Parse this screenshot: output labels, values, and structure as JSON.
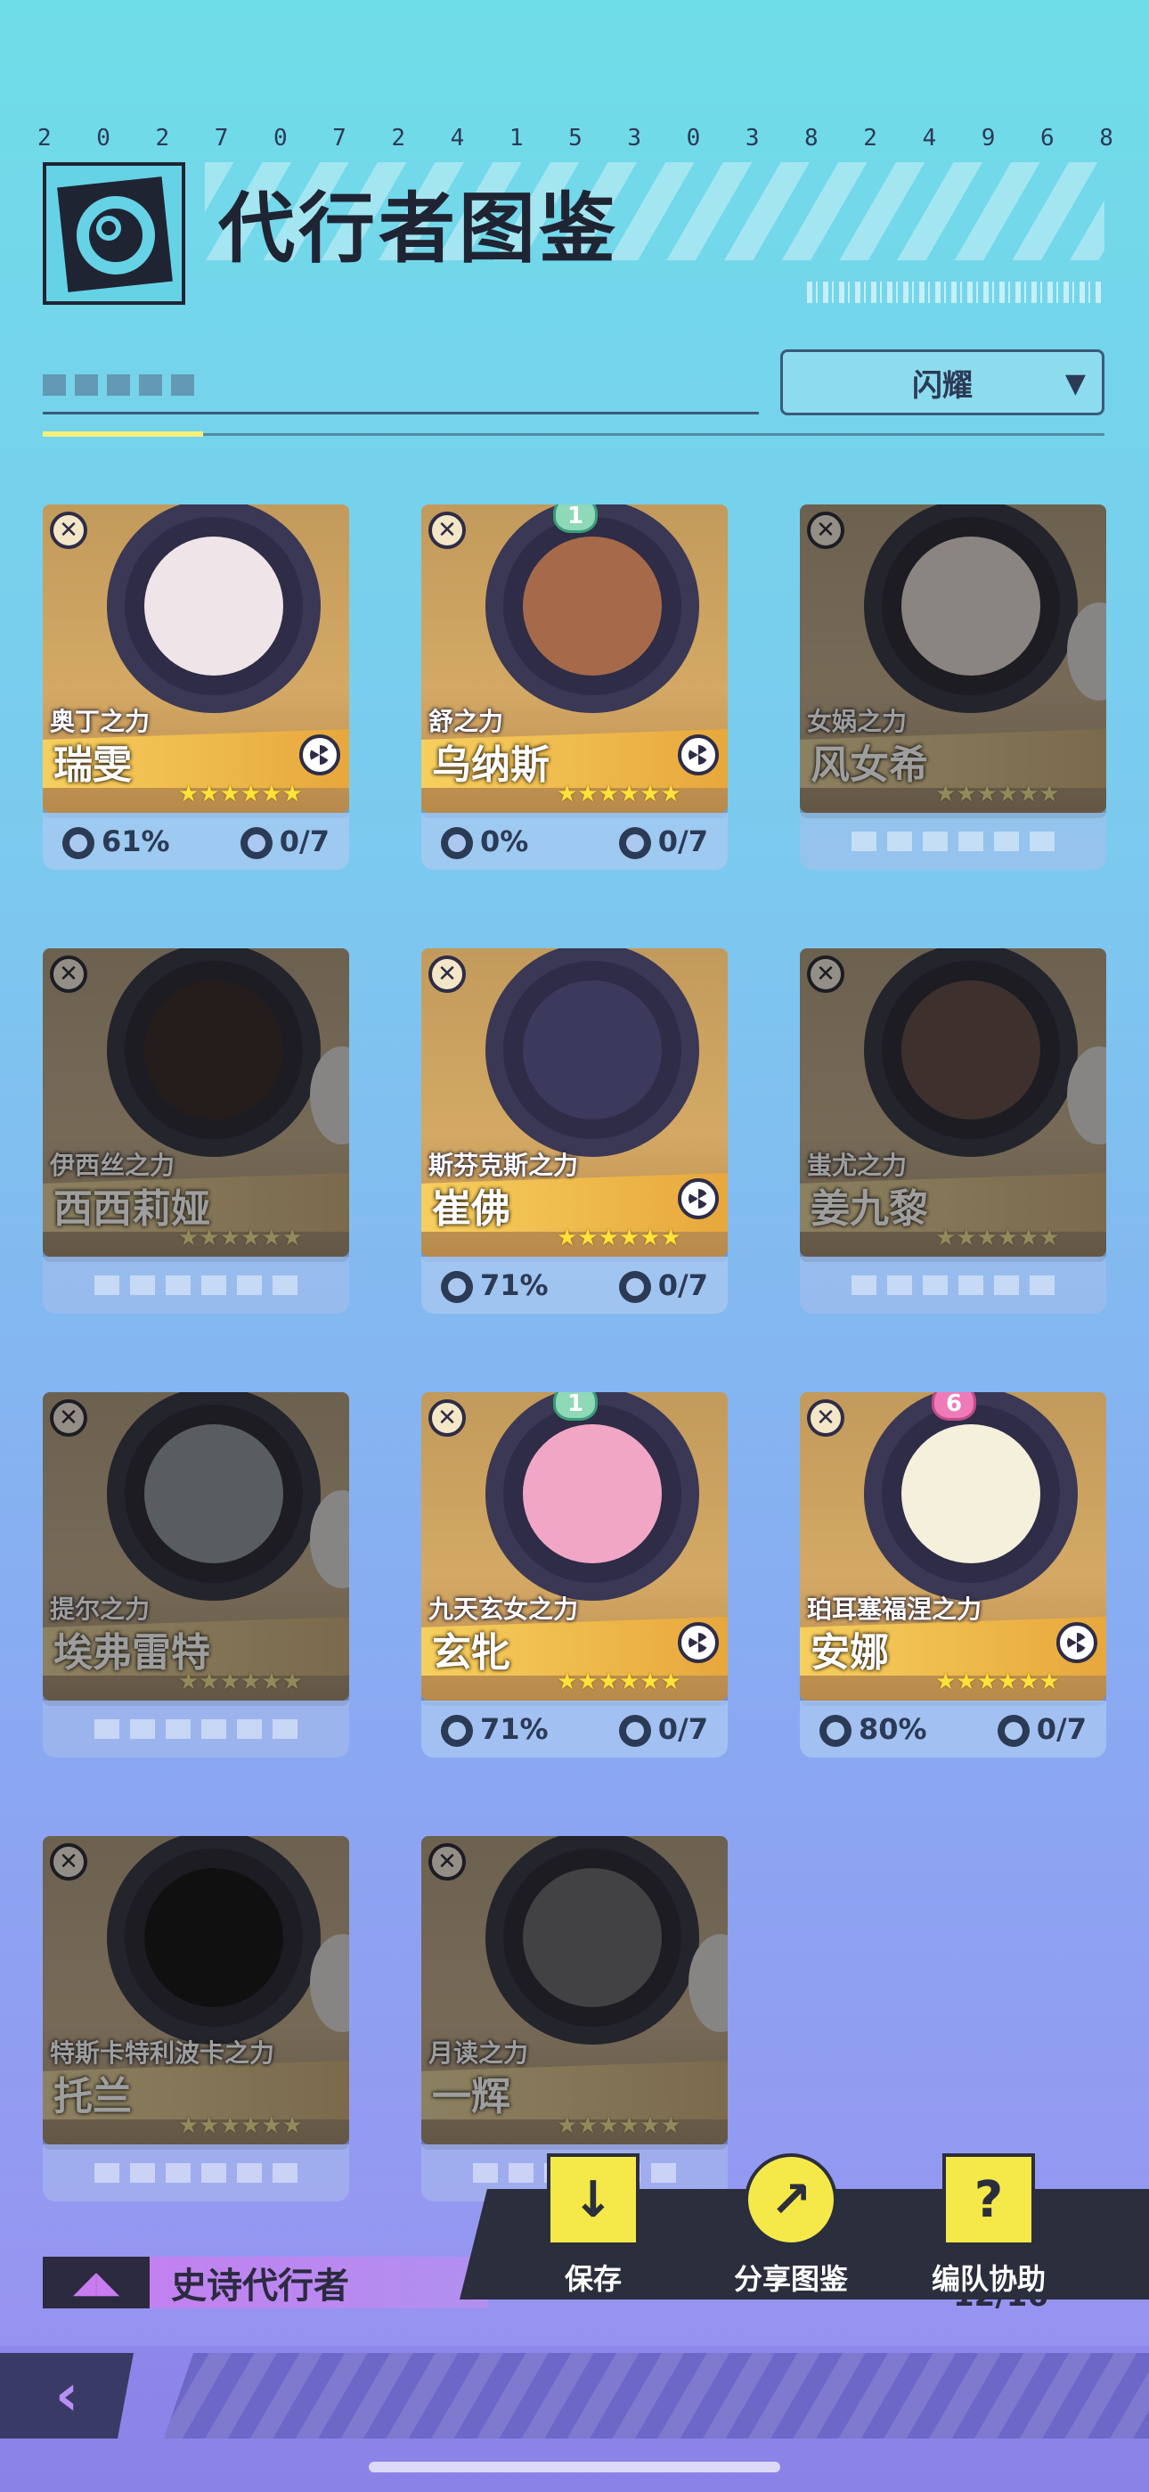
{
  "header": {
    "digits": [
      "2",
      "0",
      "2",
      "7",
      "0",
      "7",
      "2",
      "4",
      "1",
      "5",
      "3",
      "0",
      "3",
      "8",
      "2",
      "4",
      "9",
      "6",
      "8"
    ],
    "title": "代行者图鉴",
    "filter_label": "闪耀"
  },
  "agents": [
    {
      "power": "奥丁之力",
      "name": "瑞雯",
      "unlocked": true,
      "rank": "",
      "completion": "61%",
      "awaken": "0/7",
      "face": "#efe4e8"
    },
    {
      "power": "舒之力",
      "name": "乌纳斯",
      "unlocked": true,
      "rank": "1",
      "completion": "0%",
      "awaken": "0/7",
      "face": "#a66a4a"
    },
    {
      "power": "女娲之力",
      "name": "风女希",
      "unlocked": false,
      "rank": "",
      "completion": "",
      "awaken": "",
      "face": "#e9d5c6"
    },
    {
      "power": "伊西丝之力",
      "name": "西西莉娅",
      "unlocked": false,
      "rank": "",
      "completion": "",
      "awaken": "",
      "face": "#4a2a2a"
    },
    {
      "power": "斯芬克斯之力",
      "name": "崔佛",
      "unlocked": true,
      "rank": "",
      "completion": "71%",
      "awaken": "0/7",
      "face": "#3c3a5c"
    },
    {
      "power": "蚩尤之力",
      "name": "姜九黎",
      "unlocked": false,
      "rank": "",
      "completion": "",
      "awaken": "",
      "face": "#7a4a3a"
    },
    {
      "power": "提尔之力",
      "name": "埃弗雷特",
      "unlocked": false,
      "rank": "",
      "completion": "",
      "awaken": "",
      "face": "#8a96a8"
    },
    {
      "power": "九天玄女之力",
      "name": "玄牝",
      "unlocked": true,
      "rank": "1",
      "completion": "71%",
      "awaken": "0/7",
      "face": "#f2a6c6"
    },
    {
      "power": "珀耳塞福涅之力",
      "name": "安娜",
      "unlocked": true,
      "rank": "6",
      "completion": "80%",
      "awaken": "0/7",
      "face": "#f4f0dc"
    },
    {
      "power": "特斯卡特利波卡之力",
      "name": "托兰",
      "unlocked": false,
      "rank": "",
      "completion": "",
      "awaken": "",
      "face": "#1a1a1a"
    },
    {
      "power": "月读之力",
      "name": "一辉",
      "unlocked": false,
      "rank": "",
      "completion": "",
      "awaken": "",
      "face": "#6a6a72"
    }
  ],
  "section": {
    "label": "史诗代行者",
    "count": "12/16"
  },
  "actions": {
    "save": "保存",
    "share": "分享图鉴",
    "team": "编队协助"
  },
  "icons": {
    "back": "back-arrow-icon",
    "save": "download-folder-icon",
    "share": "share-icon",
    "team": "cards-icon"
  },
  "colors": {
    "accent_yellow": "#f5e94a",
    "card_gold": "#d4a965",
    "epic_purple": "#c87cf0"
  }
}
